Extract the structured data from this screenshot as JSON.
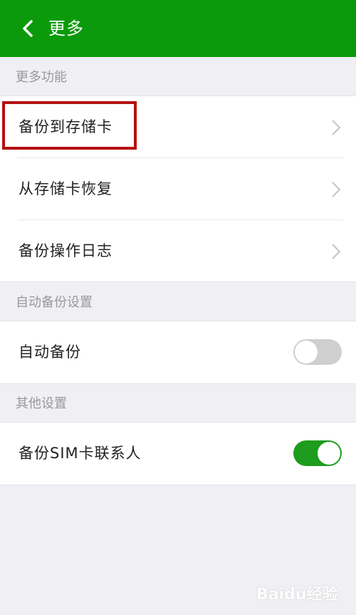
{
  "header": {
    "title": "更多",
    "back_icon": "chevron-left-icon"
  },
  "sections": {
    "more_functions": {
      "heading": "更多功能",
      "items": [
        {
          "label": "备份到存储卡",
          "icon": "chevron-right-icon"
        },
        {
          "label": "从存储卡恢复",
          "icon": "chevron-right-icon"
        },
        {
          "label": "备份操作日志",
          "icon": "chevron-right-icon"
        }
      ]
    },
    "auto_backup": {
      "heading": "自动备份设置",
      "item": {
        "label": "自动备份",
        "toggle_on": false
      }
    },
    "other": {
      "heading": "其他设置",
      "item": {
        "label": "备份SIM卡联系人",
        "toggle_on": true
      }
    }
  },
  "watermark": {
    "text": "Baidu经验"
  },
  "colors": {
    "header_bg": "#0b9a0b",
    "toggle_on": "#1d9c1d",
    "toggle_off": "#cfcfcf",
    "highlight_border": "#b50f0f",
    "page_bg": "#efeff4"
  }
}
